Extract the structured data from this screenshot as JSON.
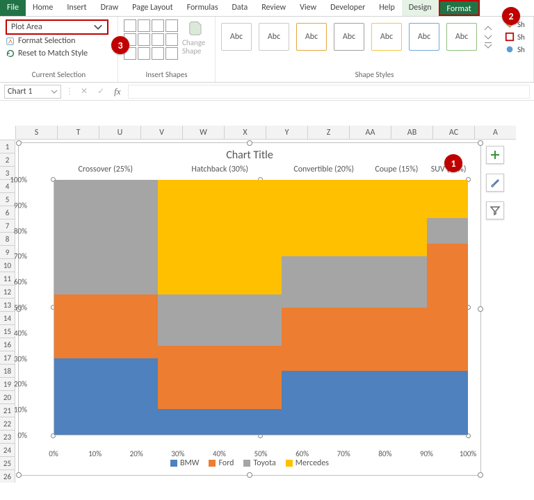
{
  "ribbon": {
    "tabs": [
      "File",
      "Home",
      "Insert",
      "Draw",
      "Page Layout",
      "Formulas",
      "Data",
      "Review",
      "View",
      "Developer",
      "Help",
      "Design",
      "Format"
    ],
    "selection_dropdown": "Plot Area",
    "format_selection": "Format Selection",
    "reset_match": "Reset to Match Style",
    "group_current": "Current Selection",
    "group_shapes": "Insert Shapes",
    "change_shape": "Change Shape",
    "group_styles": "Shape Styles",
    "abc": "Abc",
    "shape_fill": "Sh",
    "shape_outline": "Sh",
    "shape_effects": "Sh"
  },
  "formula_bar": {
    "name_box": "Chart 1"
  },
  "callouts": {
    "one": "1",
    "two": "2",
    "three": "3"
  },
  "columns": [
    "S",
    "T",
    "U",
    "V",
    "W",
    "X",
    "Y",
    "Z",
    "AA",
    "AB",
    "AC",
    "A"
  ],
  "rows": [
    "1",
    "2",
    "3",
    "4",
    "5",
    "6",
    "7",
    "8",
    "9",
    "10",
    "11",
    "12",
    "13",
    "14",
    "15",
    "16",
    "17",
    "18",
    "19",
    "20",
    "21",
    "22",
    "23",
    "24",
    "25",
    "26"
  ],
  "chart": {
    "title": "Chart Title",
    "y_ticks": [
      "0%",
      "10%",
      "20%",
      "30%",
      "40%",
      "50%",
      "60%",
      "70%",
      "80%",
      "90%",
      "100%"
    ],
    "x_ticks": [
      "0%",
      "10%",
      "20%",
      "30%",
      "40%",
      "50%",
      "60%",
      "70%",
      "80%",
      "90%",
      "100%"
    ],
    "legend": [
      "BMW",
      "Ford",
      "Toyota",
      "Mercedes"
    ],
    "cat_labels": [
      "Crossover (25%)",
      "Hatchback (30%)",
      "Convertible (20%)",
      "Coupe (15%)",
      "SUV (10%)"
    ]
  },
  "chart_data": {
    "type": "area",
    "subtype": "marimekko-stacked-100",
    "title": "Chart Title",
    "xlabel": "",
    "ylabel": "",
    "xlim": [
      0,
      100
    ],
    "ylim": [
      0,
      100
    ],
    "categories": [
      {
        "name": "Crossover",
        "width_pct": 25
      },
      {
        "name": "Hatchback",
        "width_pct": 30
      },
      {
        "name": "Convertible",
        "width_pct": 20
      },
      {
        "name": "Coupe",
        "width_pct": 15
      },
      {
        "name": "SUV",
        "width_pct": 10
      }
    ],
    "series": [
      {
        "name": "BMW",
        "values": [
          30,
          10,
          25,
          25,
          25
        ],
        "color": "#4e81bd"
      },
      {
        "name": "Ford",
        "values": [
          25,
          25,
          25,
          25,
          50
        ],
        "color": "#ed7d31"
      },
      {
        "name": "Toyota",
        "values": [
          45,
          20,
          20,
          20,
          10
        ],
        "color": "#a5a5a5"
      },
      {
        "name": "Mercedes",
        "values": [
          0,
          45,
          30,
          30,
          15
        ],
        "color": "#ffc000"
      }
    ]
  }
}
